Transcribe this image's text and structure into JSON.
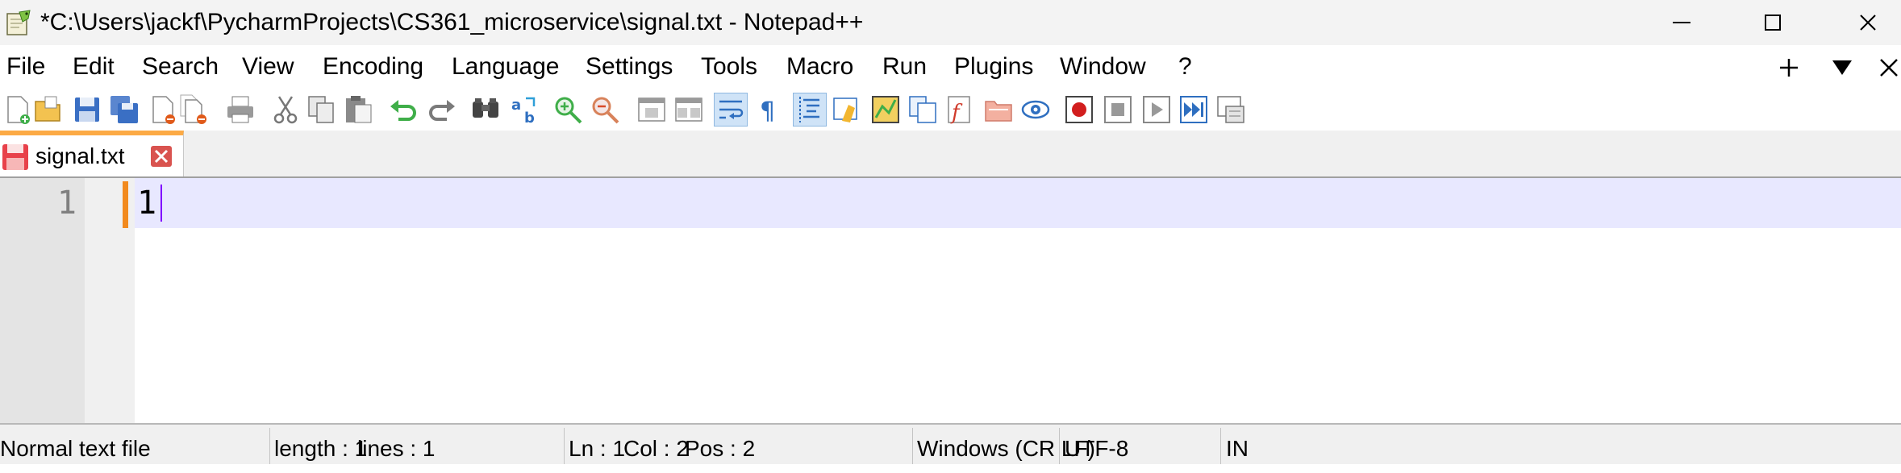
{
  "window": {
    "title": "*C:\\Users\\jackf\\PycharmProjects\\CS361_microservice\\signal.txt - Notepad++",
    "app_icon": "notepad-plus-plus-icon",
    "controls": [
      "minimize-icon",
      "maximize-icon",
      "close-icon"
    ]
  },
  "menu": {
    "items": [
      "File",
      "Edit",
      "Search",
      "View",
      "Encoding",
      "Language",
      "Settings",
      "Tools",
      "Macro",
      "Run",
      "Plugins",
      "Window",
      "?"
    ],
    "right_icons": [
      "plus-icon",
      "triangle-down-icon",
      "close-icon"
    ]
  },
  "toolbar": {
    "icons": [
      "new-file-icon",
      "open-file-icon",
      "save-icon",
      "save-all-icon",
      "close-icon",
      "close-all-icon",
      "print-icon",
      "cut-icon",
      "copy-icon",
      "paste-icon",
      "undo-icon",
      "redo-icon",
      "find-icon",
      "replace-icon",
      "zoom-in-icon",
      "zoom-out-icon",
      "sync-vertical-icon",
      "sync-horizontal-icon",
      "word-wrap-icon",
      "show-all-chars-icon",
      "indent-guide-icon",
      "udl-icon",
      "doc-map-icon",
      "doc-list-icon",
      "function-list-icon",
      "folder-workspace-icon",
      "monitoring-icon",
      "record-macro-icon",
      "stop-macro-icon",
      "play-macro-icon",
      "run-macro-multiple-icon",
      "save-macro-icon"
    ],
    "active": [
      "word-wrap-icon",
      "indent-guide-icon"
    ]
  },
  "tabs": [
    {
      "label": "signal.txt",
      "icon": "unsaved-file-icon",
      "close_icon": "close-tab-icon"
    }
  ],
  "editor": {
    "lines": [
      {
        "number": "1",
        "text": "1"
      }
    ],
    "colors": {
      "current_line": "#e8e8ff",
      "caret": "#8000ff",
      "marker": "#f28a1e"
    }
  },
  "status": {
    "file_type": "Normal text file",
    "length": "length : 1",
    "lines": "lines : 1",
    "ln": "Ln : 1",
    "col": "Col : 2",
    "pos": "Pos : 2",
    "eol": "Windows (CR LF)",
    "encoding": "UTF-8",
    "mode": "IN"
  }
}
